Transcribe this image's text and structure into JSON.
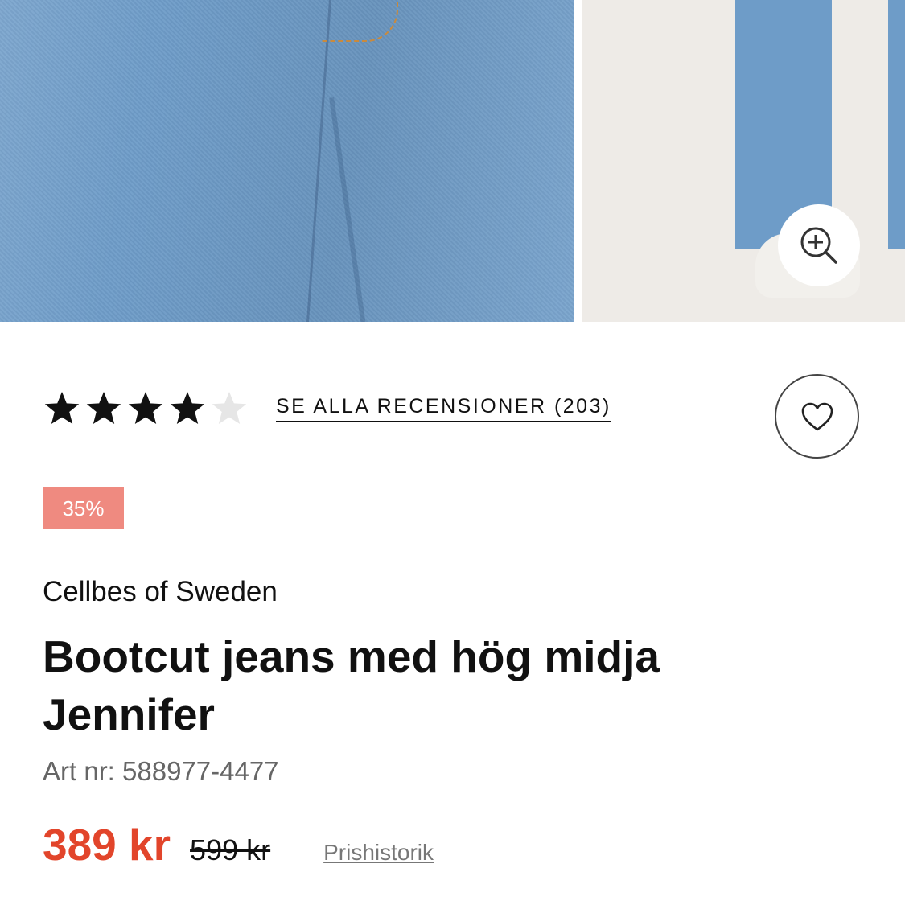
{
  "gallery": {
    "images": [
      {
        "name": "product-image-front",
        "alt": ""
      },
      {
        "name": "product-image-side",
        "alt": ""
      }
    ],
    "zoom_icon": "zoom-in-icon"
  },
  "rating": {
    "stars_filled": 4,
    "stars_total": 5,
    "reviews_link": "SE ALLA RECENSIONER (203)",
    "star_color": "#111111",
    "star_empty_color": "#e6e6e6"
  },
  "favorite": {
    "icon": "heart-icon"
  },
  "product": {
    "discount": "35%",
    "brand": "Cellbes of Sweden",
    "title": "Bootcut jeans med hög midja Jennifer",
    "art_nr": "Art nr: 588977-4477",
    "price": "389 kr",
    "old_price": "599 kr",
    "price_history": "Prishistorik"
  },
  "colors": {
    "accent_price": "#e2452b",
    "discount_badge": "#ef8a80",
    "denim": "#6e9cc8"
  }
}
